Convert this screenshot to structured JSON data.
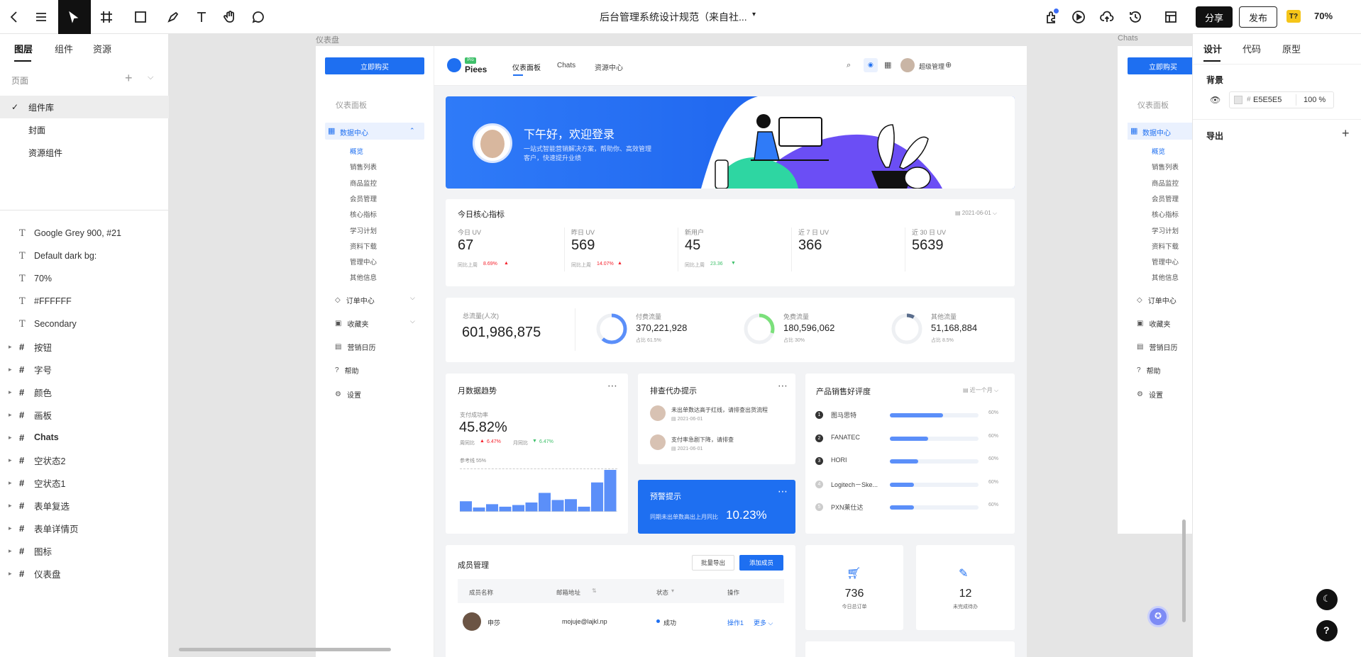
{
  "toolbar": {
    "doc_title": "后台管理系统设计规范（来自社...",
    "share": "分享",
    "publish": "发布",
    "zoom": "70%",
    "badge": "T?"
  },
  "left_panel": {
    "tabs": [
      "图层",
      "组件",
      "资源"
    ],
    "pages_label": "页面",
    "pages": [
      "组件库",
      "封面",
      "资源组件"
    ],
    "layers": [
      {
        "type": "text",
        "name": "Google Grey 900, #21"
      },
      {
        "type": "text",
        "name": "Default dark bg:"
      },
      {
        "type": "text",
        "name": "70%"
      },
      {
        "type": "text",
        "name": "#FFFFFF"
      },
      {
        "type": "text",
        "name": "Secondary"
      },
      {
        "type": "frame",
        "name": "按钮"
      },
      {
        "type": "frame",
        "name": "字号"
      },
      {
        "type": "frame",
        "name": "颜色"
      },
      {
        "type": "frame",
        "name": "画板"
      },
      {
        "type": "frame",
        "name": "Chats"
      },
      {
        "type": "frame",
        "name": "空状态2"
      },
      {
        "type": "frame",
        "name": "空状态1"
      },
      {
        "type": "frame",
        "name": "表单复选"
      },
      {
        "type": "frame",
        "name": "表单详情页"
      },
      {
        "type": "frame",
        "name": "图标"
      },
      {
        "type": "frame",
        "name": "仪表盘"
      }
    ]
  },
  "right_panel": {
    "tabs": [
      "设计",
      "代码",
      "原型"
    ],
    "bg_label": "背景",
    "bg_hex": "E5E5E5",
    "bg_opacity": "100 %",
    "export_label": "导出"
  },
  "canvas": {
    "frame_label_main": "仪表盘",
    "frame_label_chats": "Chats"
  },
  "dashboard": {
    "buy_btn": "立即购买",
    "logo_badge": "Pro",
    "logo": "Piees",
    "nav": [
      "仪表面板",
      "Chats",
      "资源中心"
    ],
    "user": "超级管理",
    "sidebar_title": "仪表面板",
    "menu_data_center": "数据中心",
    "sub_items": [
      "概览",
      "销售列表",
      "商品监控",
      "会员管理",
      "核心指标",
      "学习计划",
      "资料下载",
      "管理中心",
      "其他信息"
    ],
    "menu_order": "订单中心",
    "menu_fav": "收藏夹",
    "menu_calendar": "营销日历",
    "menu_help": "帮助",
    "menu_settings": "设置",
    "banner_title": "下午好，欢迎登录",
    "banner_sub1": "一站式智能营销解决方案，帮助你、高效管理",
    "banner_sub2": "客户，快速提升业绩",
    "core_title": "今日核心指标",
    "core_date": "2021-06-01",
    "metrics": [
      {
        "label": "今日 UV",
        "value": "67",
        "compare": "同比上周",
        "change": "8.69%",
        "dir": "up"
      },
      {
        "label": "昨日 UV",
        "value": "569",
        "compare": "同比上周",
        "change": "14.07%",
        "dir": "up"
      },
      {
        "label": "新用户",
        "value": "45",
        "compare": "同比上周",
        "change": "23.36",
        "dir": "down"
      },
      {
        "label": "近 7 日 UV",
        "value": "366",
        "compare": "",
        "change": "",
        "dir": ""
      },
      {
        "label": "近 30 日 UV",
        "value": "5639",
        "compare": "",
        "change": "",
        "dir": ""
      }
    ],
    "traffic_total_label": "总流量(人次)",
    "traffic_total": "601,986,875",
    "traffic": [
      {
        "label": "付费流量",
        "value": "370,221,928",
        "ratio": "占比 61.5%",
        "pct": 61.5,
        "color": "#5B8FF9"
      },
      {
        "label": "免费流量",
        "value": "180,596,062",
        "ratio": "占比 30%",
        "pct": 30,
        "color": "#7BE07B"
      },
      {
        "label": "其他流量",
        "value": "51,168,884",
        "ratio": "占比 8.5%",
        "pct": 8.5,
        "color": "#5A6D8C"
      }
    ],
    "monthly_title": "月数据趋势",
    "pay_rate_label": "支付成功率",
    "pay_rate": "45.82%",
    "week_label": "周同比",
    "week_change": "6.47%",
    "month_label": "月同比",
    "month_change": "6.47%",
    "ref_line": "参考线 55%",
    "monthly_bars": [
      0.25,
      0.1,
      0.18,
      0.12,
      0.16,
      0.22,
      0.45,
      0.28,
      0.3,
      0.12,
      0.7,
      1.0
    ],
    "todo_title": "排查代办提示",
    "todos": [
      {
        "text": "未出单数达高于红线，请排查出货流程",
        "date": "2021-06-01"
      },
      {
        "text": "支付率急剧下降，请排查",
        "date": "2021-06-01"
      }
    ],
    "alert_title": "预警提示",
    "alert_text": "同期未出单数高出上月同比",
    "alert_value": "10.23%",
    "rank_title": "产品销售好评度",
    "rank_period": "近一个月",
    "ranks": [
      {
        "n": "1",
        "name": "图马思特",
        "pct": 60,
        "label": "60%"
      },
      {
        "n": "2",
        "name": "FANATEC",
        "pct": 43,
        "label": "60%"
      },
      {
        "n": "3",
        "name": "HORI",
        "pct": 32,
        "label": "60%"
      },
      {
        "n": "4",
        "name": "Logitech－Ske...",
        "pct": 27,
        "label": "60%"
      },
      {
        "n": "5",
        "name": "PXN莱仕达",
        "pct": 27,
        "label": "60%"
      }
    ],
    "member_title": "成员管理",
    "export_btn": "批量导出",
    "add_btn": "添加成员",
    "table_headers": [
      "成员名称",
      "邮箱地址",
      "状态",
      "操作"
    ],
    "row": {
      "name": "申莎",
      "email": "mojuje@lajkl.np",
      "status": "成功",
      "op1": "操作1",
      "op2": "更多"
    },
    "orders_value": "736",
    "orders_label": "今日总订单",
    "pending_value": "12",
    "pending_label": "未完成待办"
  }
}
